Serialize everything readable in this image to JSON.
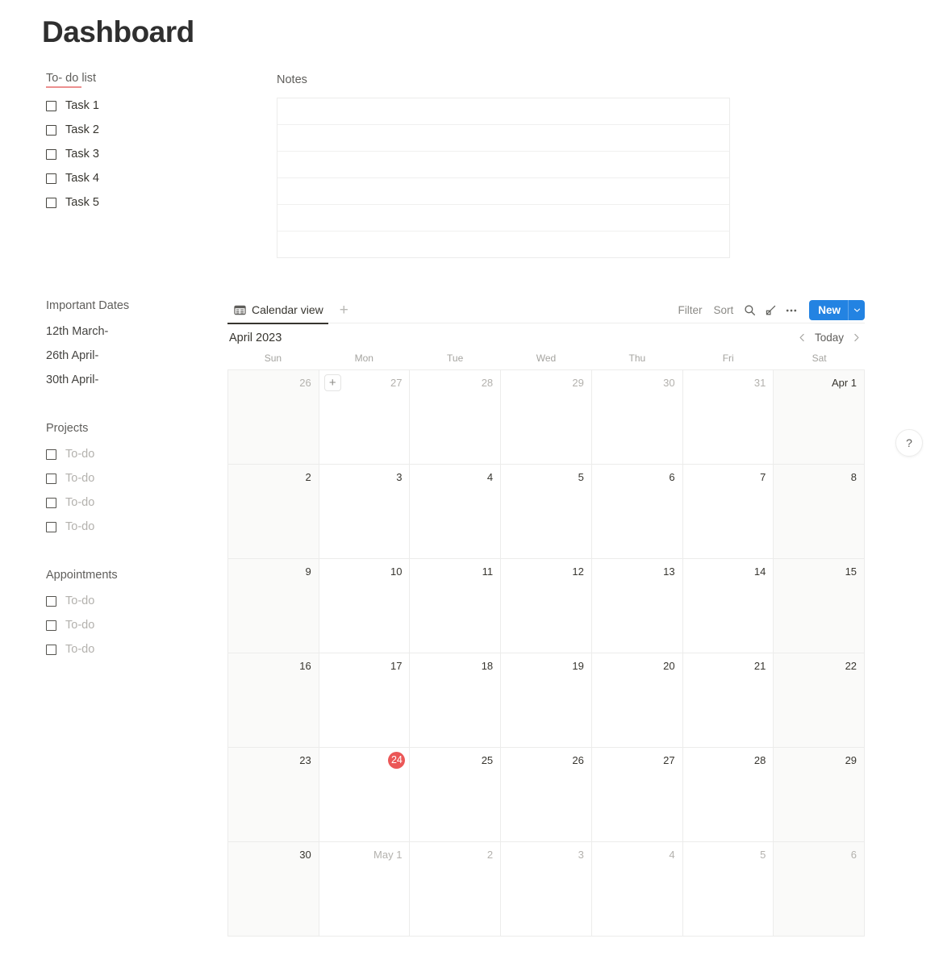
{
  "page": {
    "title": "Dashboard"
  },
  "colors": {
    "accent_blue": "#2383E2",
    "today_red": "#EB5757",
    "underline_pink": "#EC8F8F",
    "text_primary": "#37352F",
    "text_muted": "#8B8A86",
    "text_placeholder": "#B3B1AD",
    "weekend_cell": "#FAFAF9",
    "border": "#ECECEB"
  },
  "todo": {
    "heading": "To- do list",
    "items": [
      {
        "label": "Task 1",
        "checked": false
      },
      {
        "label": "Task 2",
        "checked": false
      },
      {
        "label": "Task 3",
        "checked": false
      },
      {
        "label": "Task 4",
        "checked": false
      },
      {
        "label": "Task 5",
        "checked": false
      }
    ]
  },
  "notes": {
    "heading": "Notes",
    "rows": [
      "",
      "",
      "",
      "",
      "",
      ""
    ]
  },
  "important_dates": {
    "heading": "Important Dates",
    "items": [
      "12th March-",
      "26th April-",
      "30th April-"
    ]
  },
  "projects": {
    "heading": "Projects",
    "items": [
      {
        "label": "To-do",
        "checked": false
      },
      {
        "label": "To-do",
        "checked": false
      },
      {
        "label": "To-do",
        "checked": false
      },
      {
        "label": "To-do",
        "checked": false
      }
    ]
  },
  "appointments": {
    "heading": "Appointments",
    "items": [
      {
        "label": "To-do",
        "checked": false
      },
      {
        "label": "To-do",
        "checked": false
      },
      {
        "label": "To-do",
        "checked": false
      }
    ]
  },
  "calendar": {
    "toolbar": {
      "view_tab_label": "Calendar view",
      "view_tab_icon": "table-view-icon",
      "add_view_label": "+",
      "filter_label": "Filter",
      "sort_label": "Sort",
      "search_icon": "search-icon",
      "expand_icon": "expand-diagonal-icon",
      "more_icon": "more-horizontal-icon",
      "new_label": "New",
      "new_caret_icon": "chevron-down-icon"
    },
    "month_label": "April 2023",
    "nav": {
      "prev_icon": "chevron-left-icon",
      "today_label": "Today",
      "next_icon": "chevron-right-icon"
    },
    "weekdays": [
      "Sun",
      "Mon",
      "Tue",
      "Wed",
      "Thu",
      "Fri",
      "Sat"
    ],
    "cell_add_label": "+",
    "weeks": [
      [
        {
          "label": "26",
          "dim": true,
          "weekend": true,
          "today": false,
          "add_button": false
        },
        {
          "label": "27",
          "dim": true,
          "weekend": false,
          "today": false,
          "add_button": true
        },
        {
          "label": "28",
          "dim": true,
          "weekend": false,
          "today": false,
          "add_button": false
        },
        {
          "label": "29",
          "dim": true,
          "weekend": false,
          "today": false,
          "add_button": false
        },
        {
          "label": "30",
          "dim": true,
          "weekend": false,
          "today": false,
          "add_button": false
        },
        {
          "label": "31",
          "dim": true,
          "weekend": false,
          "today": false,
          "add_button": false
        },
        {
          "label": "Apr 1",
          "dim": false,
          "weekend": true,
          "today": false,
          "add_button": false
        }
      ],
      [
        {
          "label": "2",
          "dim": false,
          "weekend": true,
          "today": false,
          "add_button": false
        },
        {
          "label": "3",
          "dim": false,
          "weekend": false,
          "today": false,
          "add_button": false
        },
        {
          "label": "4",
          "dim": false,
          "weekend": false,
          "today": false,
          "add_button": false
        },
        {
          "label": "5",
          "dim": false,
          "weekend": false,
          "today": false,
          "add_button": false
        },
        {
          "label": "6",
          "dim": false,
          "weekend": false,
          "today": false,
          "add_button": false
        },
        {
          "label": "7",
          "dim": false,
          "weekend": false,
          "today": false,
          "add_button": false
        },
        {
          "label": "8",
          "dim": false,
          "weekend": true,
          "today": false,
          "add_button": false
        }
      ],
      [
        {
          "label": "9",
          "dim": false,
          "weekend": true,
          "today": false,
          "add_button": false
        },
        {
          "label": "10",
          "dim": false,
          "weekend": false,
          "today": false,
          "add_button": false
        },
        {
          "label": "11",
          "dim": false,
          "weekend": false,
          "today": false,
          "add_button": false
        },
        {
          "label": "12",
          "dim": false,
          "weekend": false,
          "today": false,
          "add_button": false
        },
        {
          "label": "13",
          "dim": false,
          "weekend": false,
          "today": false,
          "add_button": false
        },
        {
          "label": "14",
          "dim": false,
          "weekend": false,
          "today": false,
          "add_button": false
        },
        {
          "label": "15",
          "dim": false,
          "weekend": true,
          "today": false,
          "add_button": false
        }
      ],
      [
        {
          "label": "16",
          "dim": false,
          "weekend": true,
          "today": false,
          "add_button": false
        },
        {
          "label": "17",
          "dim": false,
          "weekend": false,
          "today": false,
          "add_button": false
        },
        {
          "label": "18",
          "dim": false,
          "weekend": false,
          "today": false,
          "add_button": false
        },
        {
          "label": "19",
          "dim": false,
          "weekend": false,
          "today": false,
          "add_button": false
        },
        {
          "label": "20",
          "dim": false,
          "weekend": false,
          "today": false,
          "add_button": false
        },
        {
          "label": "21",
          "dim": false,
          "weekend": false,
          "today": false,
          "add_button": false
        },
        {
          "label": "22",
          "dim": false,
          "weekend": true,
          "today": false,
          "add_button": false
        }
      ],
      [
        {
          "label": "23",
          "dim": false,
          "weekend": true,
          "today": false,
          "add_button": false
        },
        {
          "label": "24",
          "dim": false,
          "weekend": false,
          "today": true,
          "add_button": false
        },
        {
          "label": "25",
          "dim": false,
          "weekend": false,
          "today": false,
          "add_button": false
        },
        {
          "label": "26",
          "dim": false,
          "weekend": false,
          "today": false,
          "add_button": false
        },
        {
          "label": "27",
          "dim": false,
          "weekend": false,
          "today": false,
          "add_button": false
        },
        {
          "label": "28",
          "dim": false,
          "weekend": false,
          "today": false,
          "add_button": false
        },
        {
          "label": "29",
          "dim": false,
          "weekend": true,
          "today": false,
          "add_button": false
        }
      ],
      [
        {
          "label": "30",
          "dim": false,
          "weekend": true,
          "today": false,
          "add_button": false
        },
        {
          "label": "May 1",
          "dim": true,
          "weekend": false,
          "today": false,
          "add_button": false
        },
        {
          "label": "2",
          "dim": true,
          "weekend": false,
          "today": false,
          "add_button": false
        },
        {
          "label": "3",
          "dim": true,
          "weekend": false,
          "today": false,
          "add_button": false
        },
        {
          "label": "4",
          "dim": true,
          "weekend": false,
          "today": false,
          "add_button": false
        },
        {
          "label": "5",
          "dim": true,
          "weekend": false,
          "today": false,
          "add_button": false
        },
        {
          "label": "6",
          "dim": true,
          "weekend": true,
          "today": false,
          "add_button": false
        }
      ]
    ]
  },
  "help": {
    "label": "?"
  }
}
